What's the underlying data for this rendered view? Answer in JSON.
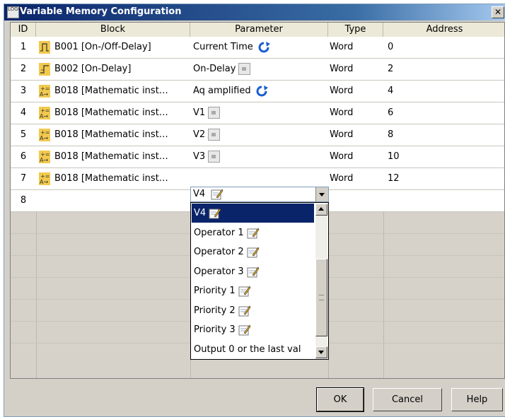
{
  "window": {
    "title": "Variable Memory Configuration",
    "icon_label": "LOGO!"
  },
  "columns": {
    "id": "ID",
    "block": "Block",
    "parameter": "Parameter",
    "type": "Type",
    "address": "Address"
  },
  "rows": [
    {
      "id": "1",
      "block": "B001 [On-/Off-Delay]",
      "block_icon": "on-off-delay-icon",
      "parameter": "Current Time",
      "param_icon": "refresh",
      "type": "Word",
      "address": "0"
    },
    {
      "id": "2",
      "block": "B002 [On-Delay]",
      "block_icon": "on-delay-icon",
      "parameter": "On-Delay",
      "param_icon": "lock",
      "type": "Word",
      "address": "2"
    },
    {
      "id": "3",
      "block": "B018 [Mathematic inst…",
      "block_icon": "math-icon",
      "parameter": "Aq amplified",
      "param_icon": "refresh",
      "type": "Word",
      "address": "4"
    },
    {
      "id": "4",
      "block": "B018 [Mathematic inst…",
      "block_icon": "math-icon",
      "parameter": "V1",
      "param_icon": "lock",
      "type": "Word",
      "address": "6"
    },
    {
      "id": "5",
      "block": "B018 [Mathematic inst…",
      "block_icon": "math-icon",
      "parameter": "V2",
      "param_icon": "lock",
      "type": "Word",
      "address": "8"
    },
    {
      "id": "6",
      "block": "B018 [Mathematic inst…",
      "block_icon": "math-icon",
      "parameter": "V3",
      "param_icon": "lock",
      "type": "Word",
      "address": "10"
    },
    {
      "id": "7",
      "block": "B018 [Mathematic inst…",
      "block_icon": "math-icon",
      "parameter": "V4",
      "param_icon": "pencil",
      "type": "Word",
      "address": "12"
    },
    {
      "id": "8",
      "block": "",
      "parameter": "",
      "type": "",
      "address": ""
    }
  ],
  "combo": {
    "value": "V4"
  },
  "dropdown": {
    "selected_index": 0,
    "options": [
      "V4",
      "Operator 1",
      "Operator 2",
      "Operator 3",
      "Priority 1",
      "Priority 2",
      "Priority 3",
      "Output 0 or the last val"
    ]
  },
  "buttons": {
    "ok": "OK",
    "cancel": "Cancel",
    "help": "Help"
  },
  "colors": {
    "title_bar": "#0a246a",
    "selection": "#0a246a",
    "block_icon": "#f0c040",
    "refresh_icon": "#1a5fd0"
  }
}
